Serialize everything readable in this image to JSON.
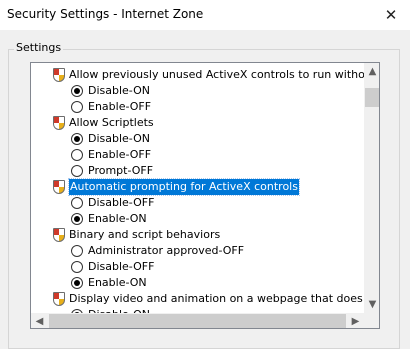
{
  "window": {
    "title": "Security Settings - Internet Zone",
    "close_glyph": "✕"
  },
  "group": {
    "label": "Settings"
  },
  "tree": {
    "scroll_up_glyph": "▲",
    "scroll_down_glyph": "▼",
    "scroll_left_glyph": "◀",
    "scroll_right_glyph": "▶",
    "selected_color": "#0078d7",
    "items": [
      {
        "kind": "setting",
        "label": "Allow previously unused ActiveX controls to run without prom"
      },
      {
        "kind": "option",
        "label": "Disable-ON",
        "checked": true
      },
      {
        "kind": "option",
        "label": "Enable-OFF",
        "checked": false
      },
      {
        "kind": "setting",
        "label": "Allow Scriptlets"
      },
      {
        "kind": "option",
        "label": "Disable-ON",
        "checked": true
      },
      {
        "kind": "option",
        "label": "Enable-OFF",
        "checked": false
      },
      {
        "kind": "option",
        "label": "Prompt-OFF",
        "checked": false
      },
      {
        "kind": "setting",
        "label": "Automatic prompting for ActiveX controls",
        "selected": true
      },
      {
        "kind": "option",
        "label": "Disable-OFF",
        "checked": false
      },
      {
        "kind": "option",
        "label": "Enable-ON",
        "checked": true
      },
      {
        "kind": "setting",
        "label": "Binary and script behaviors"
      },
      {
        "kind": "option",
        "label": "Administrator approved-OFF",
        "checked": false
      },
      {
        "kind": "option",
        "label": "Disable-OFF",
        "checked": false
      },
      {
        "kind": "option",
        "label": "Enable-ON",
        "checked": true
      },
      {
        "kind": "setting",
        "label": "Display video and animation on a webpage that does not use"
      },
      {
        "kind": "option",
        "label": "Disable-ON",
        "checked": true
      }
    ]
  }
}
